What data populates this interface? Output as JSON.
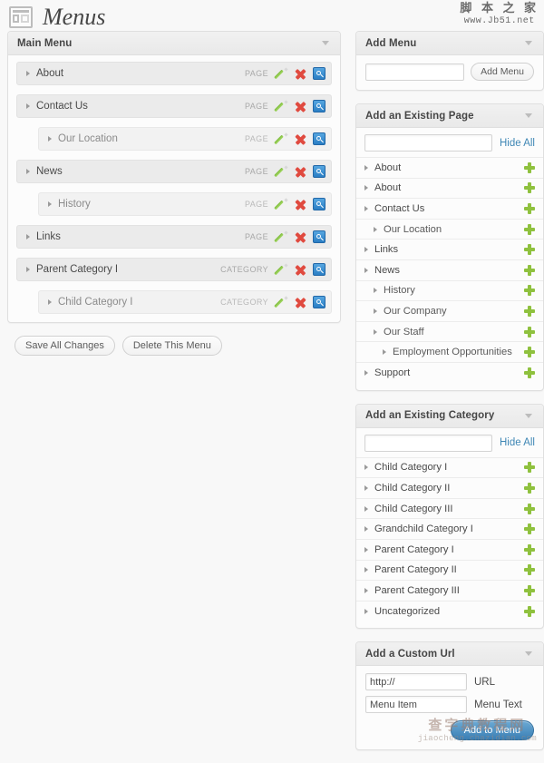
{
  "header": {
    "title": "Menus",
    "icon": "layout-page-icon"
  },
  "main_menu_panel": {
    "title": "Main Menu",
    "items": [
      {
        "label": "About",
        "type": "PAGE",
        "depth": 0
      },
      {
        "label": "Contact Us",
        "type": "PAGE",
        "depth": 0
      },
      {
        "label": "Our Location",
        "type": "PAGE",
        "depth": 1
      },
      {
        "label": "News",
        "type": "PAGE",
        "depth": 0
      },
      {
        "label": "History",
        "type": "PAGE",
        "depth": 1
      },
      {
        "label": "Links",
        "type": "PAGE",
        "depth": 0
      },
      {
        "label": "Parent Category I",
        "type": "CATEGORY",
        "depth": 0
      },
      {
        "label": "Child Category I",
        "type": "CATEGORY",
        "depth": 1
      }
    ],
    "row_icons": {
      "edit": "pencil-icon",
      "delete": "x-delete-icon",
      "view": "search-icon"
    }
  },
  "menu_actions": {
    "save_label": "Save All Changes",
    "delete_label": "Delete This Menu"
  },
  "add_menu_panel": {
    "title": "Add Menu",
    "input_value": "",
    "input_placeholder": "",
    "button_label": "Add Menu"
  },
  "add_page_panel": {
    "title": "Add an Existing Page",
    "search_value": "",
    "search_placeholder": "",
    "hide_all_label": "Hide All",
    "items": [
      {
        "label": "About",
        "depth": 0
      },
      {
        "label": "About",
        "depth": 0
      },
      {
        "label": "Contact Us",
        "depth": 0
      },
      {
        "label": "Our Location",
        "depth": 1
      },
      {
        "label": "Links",
        "depth": 0
      },
      {
        "label": "News",
        "depth": 0
      },
      {
        "label": "History",
        "depth": 1
      },
      {
        "label": "Our Company",
        "depth": 1
      },
      {
        "label": "Our Staff",
        "depth": 1
      },
      {
        "label": "Employment Opportunities",
        "depth": 2
      },
      {
        "label": "Support",
        "depth": 0
      }
    ]
  },
  "add_category_panel": {
    "title": "Add an Existing Category",
    "search_value": "",
    "search_placeholder": "",
    "hide_all_label": "Hide All",
    "items": [
      {
        "label": "Child Category I",
        "depth": 0
      },
      {
        "label": "Child Category II",
        "depth": 0
      },
      {
        "label": "Child Category III",
        "depth": 0
      },
      {
        "label": "Grandchild Category I",
        "depth": 0
      },
      {
        "label": "Parent Category I",
        "depth": 0
      },
      {
        "label": "Parent Category II",
        "depth": 0
      },
      {
        "label": "Parent Category III",
        "depth": 0
      },
      {
        "label": "Uncategorized",
        "depth": 0
      }
    ]
  },
  "add_url_panel": {
    "title": "Add a Custom Url",
    "url_value": "http://",
    "url_label": "URL",
    "text_value": "Menu Item",
    "text_label": "Menu Text",
    "submit_label": "Add to Menu"
  },
  "watermarks": {
    "top_right_cn": "脚 本 之 家",
    "top_right_url": "www.Jb51.net",
    "bottom_right_cn": "查字典教程网",
    "bottom_right_url": "jiaocheng.chazidian.com"
  },
  "colors": {
    "accent_blue": "#3a7fb5",
    "add_green": "#8fc13e",
    "delete_red": "#e04a3f",
    "edit_green": "#7dbb3a",
    "panel_bg": "#fcfcfc",
    "page_bg": "#f8f8f8"
  }
}
